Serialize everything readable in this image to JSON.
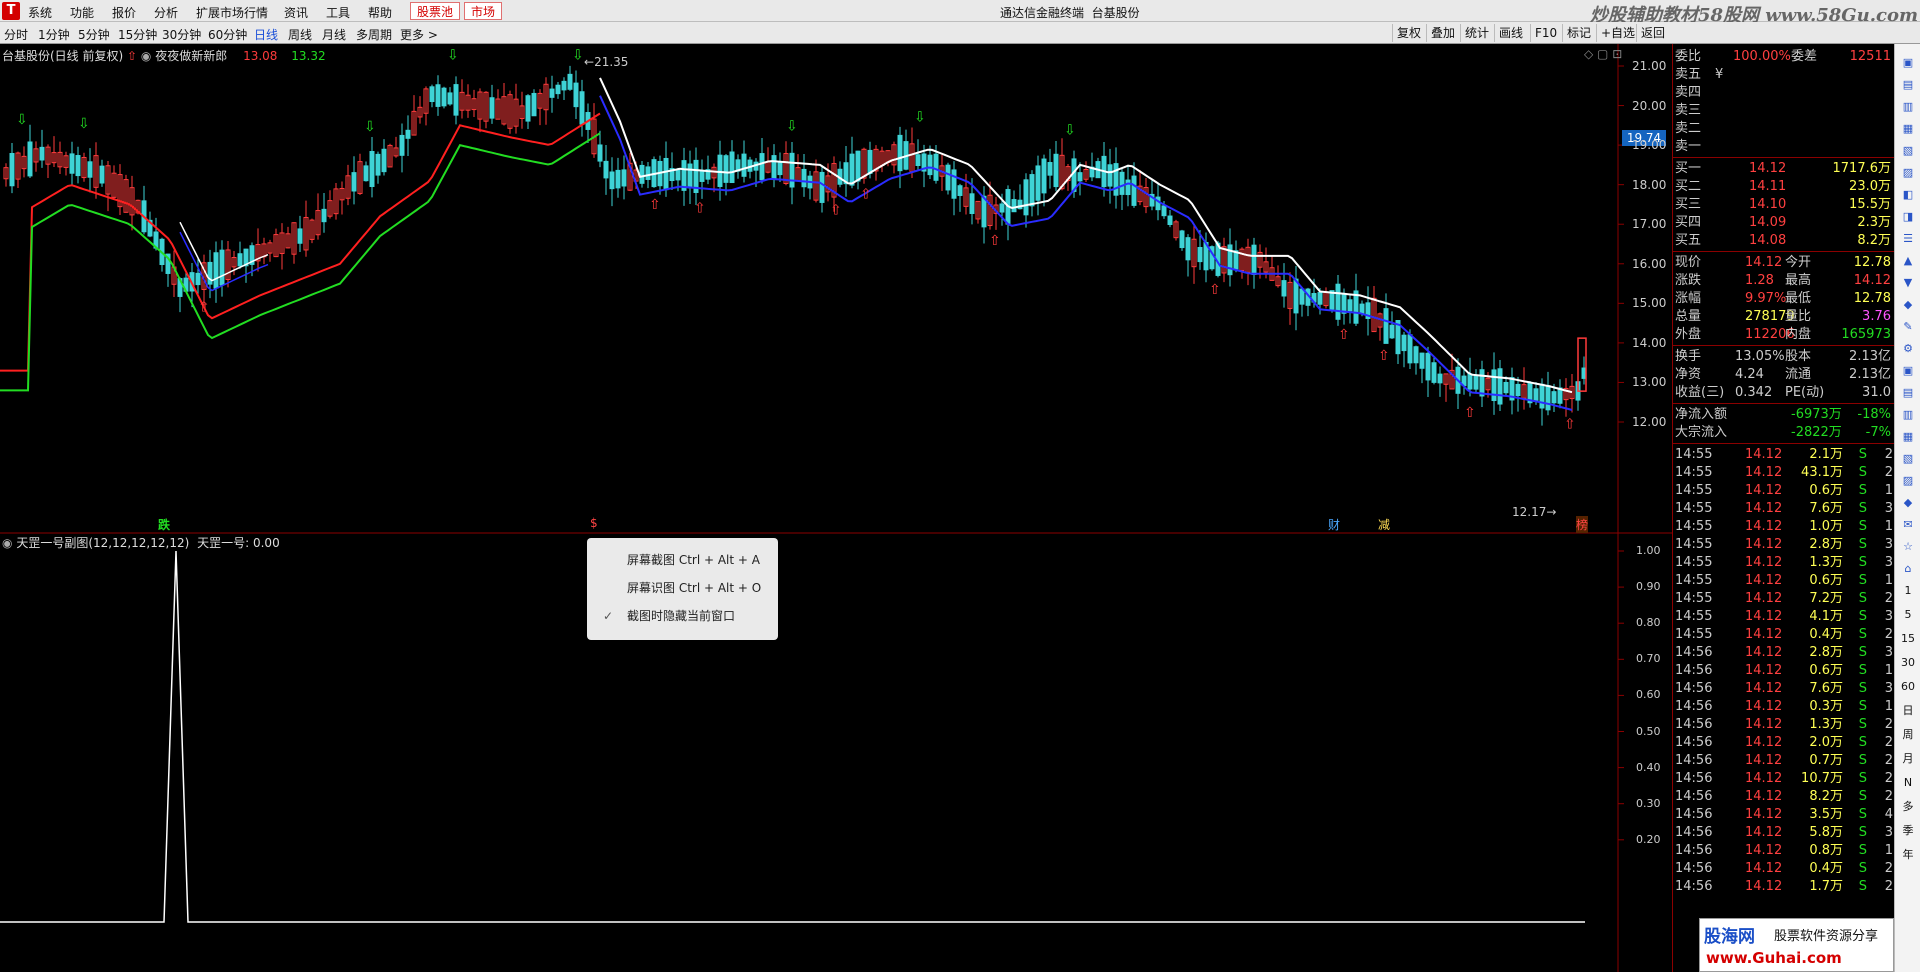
{
  "app": {
    "title": "通达信金融终端",
    "stock": "台基股份",
    "menu": [
      "系统",
      "功能",
      "报价",
      "分析",
      "扩展市场行情",
      "资讯",
      "工具",
      "帮助"
    ],
    "pool_btn": "股票池",
    "market_btn": "市场",
    "watermark": "炒股辅助教材58股网 www.58Gu.com"
  },
  "period_tabs": [
    "分时",
    "1分钟",
    "5分钟",
    "15分钟",
    "30分钟",
    "60分钟",
    "日线",
    "周线",
    "月线",
    "多周期",
    "更多 >"
  ],
  "active_tab": "日线",
  "toolbar_buttons": [
    "复权",
    "叠加",
    "统计",
    "画线",
    "F10",
    "标记",
    "+自选",
    "返回"
  ],
  "main_chart": {
    "header": "台基股份(日线 前复权)",
    "indicator_name": "夜夜做新新郎",
    "ind_val1": "13.08",
    "ind_val2": "13.32",
    "hi_label": "21.35",
    "lo_label": "12.17",
    "price_axis": [
      "21.00",
      "20.00",
      "19.00",
      "18.00",
      "17.00",
      "16.00",
      "15.00",
      "14.00",
      "13.00",
      "12.00"
    ],
    "current_price_tag": "19.74",
    "event_labels": [
      {
        "text": "跌",
        "color": "#22dd22"
      },
      {
        "text": "$",
        "color": "#ff4444"
      },
      {
        "text": "财",
        "color": "#4aa8ff"
      },
      {
        "text": "减",
        "color": "#ffdd55"
      },
      {
        "text": "榜",
        "color": "#ff4444"
      }
    ]
  },
  "sub_chart": {
    "header": "天罡一号副图(12,12,12,12,12)",
    "value_label": "天罡一号: 0.00",
    "axis": [
      "1.00",
      "0.90",
      "0.80",
      "0.70",
      "0.60",
      "0.50",
      "0.40",
      "0.30",
      "0.20"
    ]
  },
  "context_menu": {
    "items": [
      "屏幕截图 Ctrl + Alt + A",
      "屏幕识图 Ctrl + Alt + O",
      "截图时隐藏当前窗口"
    ],
    "checked_index": 2
  },
  "quote_panel": {
    "weibi": {
      "label": "委比",
      "value": "100.00%",
      "label2": "委差",
      "value2": "12511"
    },
    "sells": [
      {
        "label": "卖五",
        "price": "¥",
        "vol": ""
      },
      {
        "label": "卖四",
        "price": "",
        "vol": ""
      },
      {
        "label": "卖三",
        "price": "",
        "vol": ""
      },
      {
        "label": "卖二",
        "price": "",
        "vol": ""
      },
      {
        "label": "卖一",
        "price": "",
        "vol": ""
      }
    ],
    "buys": [
      {
        "label": "买一",
        "price": "14.12",
        "vol": "1717.6万"
      },
      {
        "label": "买二",
        "price": "14.11",
        "vol": "23.0万"
      },
      {
        "label": "买三",
        "price": "14.10",
        "vol": "15.5万"
      },
      {
        "label": "买四",
        "price": "14.09",
        "vol": "2.3万"
      },
      {
        "label": "买五",
        "price": "14.08",
        "vol": "8.2万"
      }
    ],
    "stats": [
      {
        "l1": "现价",
        "v1": "14.12",
        "l2": "今开",
        "v2": "12.78",
        "c1": "#ff4040",
        "c2": "#ffff55"
      },
      {
        "l1": "涨跌",
        "v1": "1.28",
        "l2": "最高",
        "v2": "14.12",
        "c1": "#ff4040",
        "c2": "#ff4040"
      },
      {
        "l1": "涨幅",
        "v1": "9.97%",
        "l2": "最低",
        "v2": "12.78",
        "c1": "#ff4040",
        "c2": "#ffff55"
      },
      {
        "l1": "总量",
        "v1": "278179",
        "l2": "量比",
        "v2": "3.76",
        "c1": "#ffff55",
        "c2": "#ff55ff"
      },
      {
        "l1": "外盘",
        "v1": "112206",
        "l2": "内盘",
        "v2": "165973",
        "c1": "#ff4040",
        "c2": "#22dd22"
      }
    ],
    "stats2": [
      {
        "l1": "换手",
        "v1": "13.05%",
        "l2": "股本",
        "v2": "2.13亿"
      },
      {
        "l1": "净资",
        "v1": "4.24",
        "l2": "流通",
        "v2": "2.13亿"
      },
      {
        "l1": "收益(三)",
        "v1": "0.342",
        "l2": "PE(动)",
        "v2": "31.0"
      }
    ],
    "flows": [
      {
        "label": "净流入额",
        "value": "-6973万",
        "pct": "-18%"
      },
      {
        "label": "大宗流入",
        "value": "-2822万",
        "pct": "-7%"
      }
    ],
    "ticks": [
      [
        "14:55",
        "14.12",
        "2.1万",
        "S",
        "2"
      ],
      [
        "14:55",
        "14.12",
        "43.1万",
        "S",
        "2"
      ],
      [
        "14:55",
        "14.12",
        "0.6万",
        "S",
        "1"
      ],
      [
        "14:55",
        "14.12",
        "7.6万",
        "S",
        "3"
      ],
      [
        "14:55",
        "14.12",
        "1.0万",
        "S",
        "1"
      ],
      [
        "14:55",
        "14.12",
        "2.8万",
        "S",
        "3"
      ],
      [
        "14:55",
        "14.12",
        "1.3万",
        "S",
        "3"
      ],
      [
        "14:55",
        "14.12",
        "0.6万",
        "S",
        "1"
      ],
      [
        "14:55",
        "14.12",
        "7.2万",
        "S",
        "2"
      ],
      [
        "14:55",
        "14.12",
        "4.1万",
        "S",
        "3"
      ],
      [
        "14:55",
        "14.12",
        "0.4万",
        "S",
        "2"
      ],
      [
        "14:56",
        "14.12",
        "2.8万",
        "S",
        "3"
      ],
      [
        "14:56",
        "14.12",
        "0.6万",
        "S",
        "1"
      ],
      [
        "14:56",
        "14.12",
        "7.6万",
        "S",
        "3"
      ],
      [
        "14:56",
        "14.12",
        "0.3万",
        "S",
        "1"
      ],
      [
        "14:56",
        "14.12",
        "1.3万",
        "S",
        "2"
      ],
      [
        "14:56",
        "14.12",
        "2.0万",
        "S",
        "2"
      ],
      [
        "14:56",
        "14.12",
        "0.7万",
        "S",
        "2"
      ],
      [
        "14:56",
        "14.12",
        "10.7万",
        "S",
        "2"
      ],
      [
        "14:56",
        "14.12",
        "8.2万",
        "S",
        "2"
      ],
      [
        "14:56",
        "14.12",
        "3.5万",
        "S",
        "4"
      ],
      [
        "14:56",
        "14.12",
        "5.8万",
        "S",
        "3"
      ],
      [
        "14:56",
        "14.12",
        "0.8万",
        "S",
        "1"
      ],
      [
        "14:56",
        "14.12",
        "0.4万",
        "S",
        "2"
      ],
      [
        "14:56",
        "14.12",
        "1.7万",
        "S",
        "2"
      ]
    ]
  },
  "sidebar": [
    "1",
    "5",
    "15",
    "30",
    "60",
    "日",
    "周",
    "月",
    "N",
    "多",
    "季",
    "年"
  ],
  "banner": {
    "brand": "股海网",
    "slogan": "股票软件资源分享",
    "url": "www.Guhai.com"
  },
  "colors": {
    "up": "#ff3b3b",
    "down": "#3ed3d6",
    "ma_white": "#ffffff",
    "ma_blue": "#2a2cff",
    "ma_red": "#ff2020",
    "ma_green": "#22dd22"
  }
}
